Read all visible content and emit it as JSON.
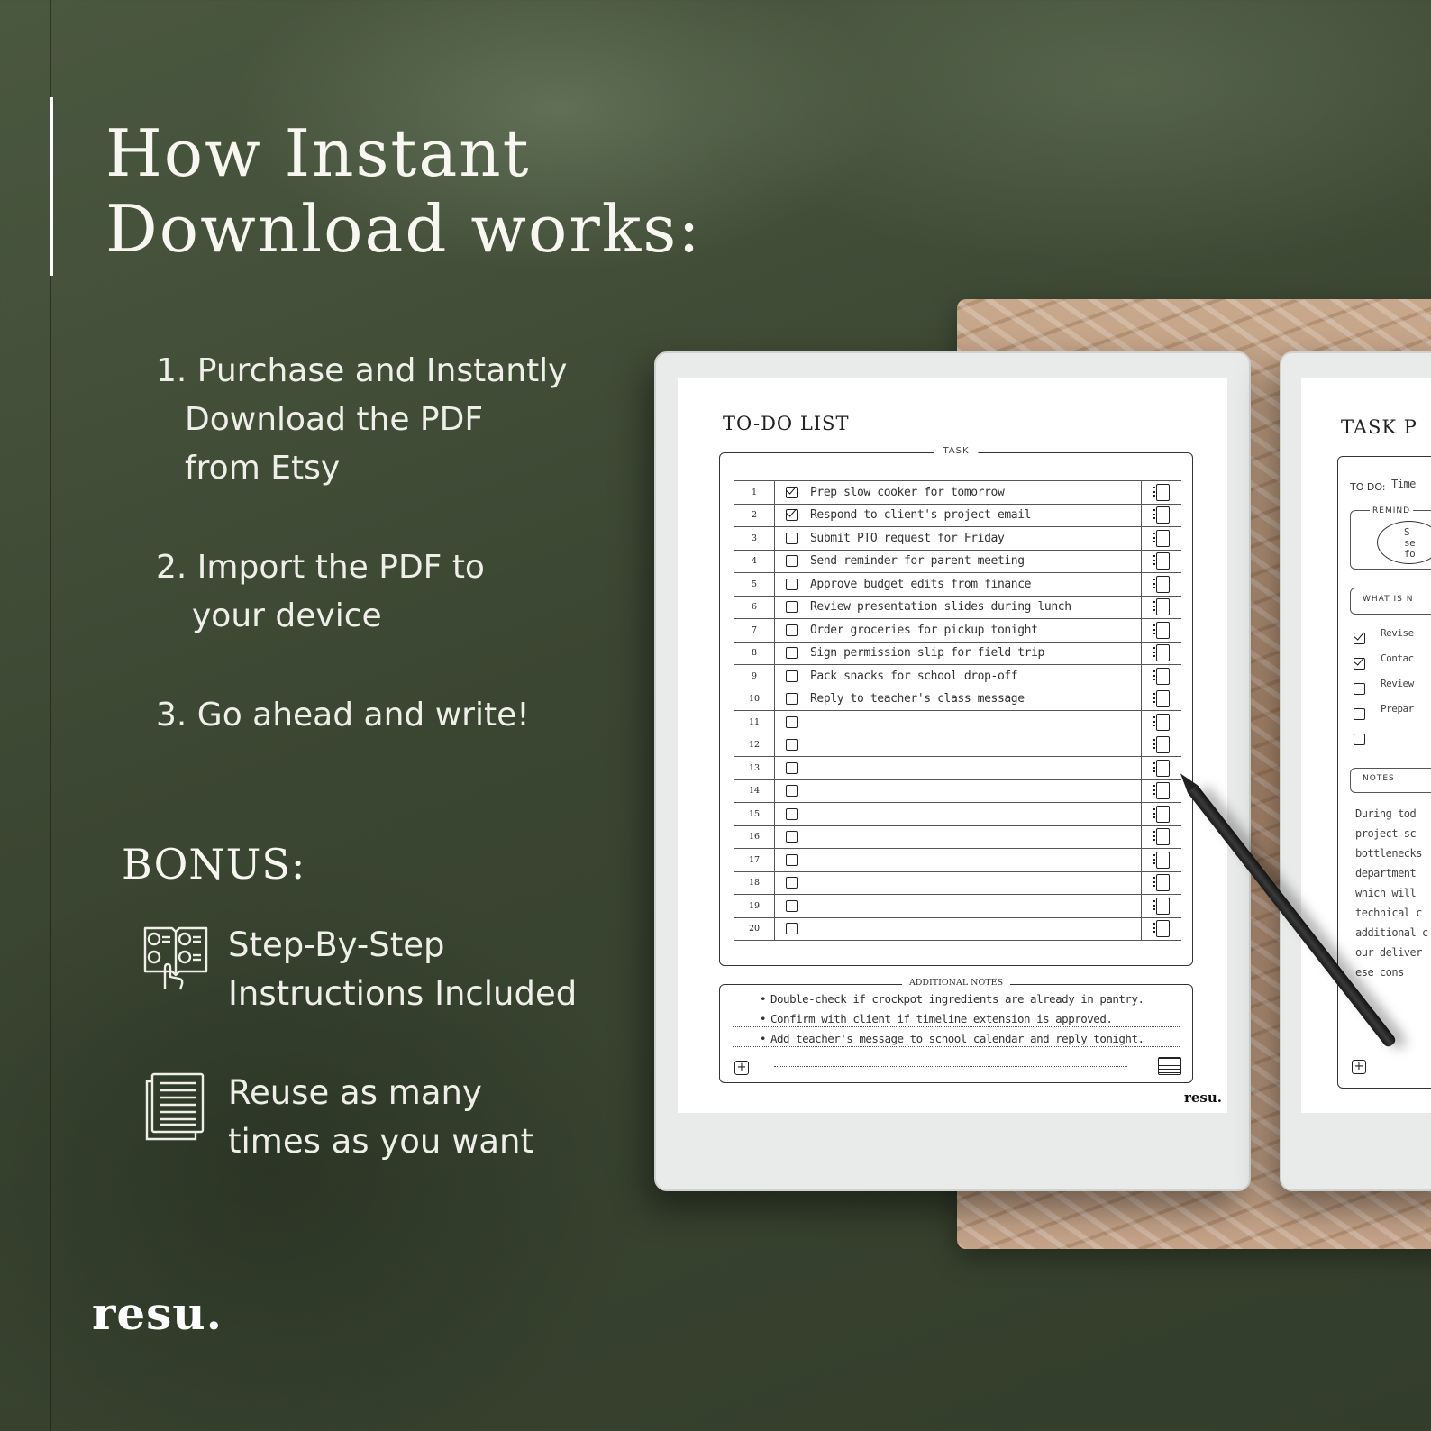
{
  "heading": {
    "line1": "How Instant",
    "line2": "Download works:"
  },
  "steps": [
    {
      "lines": [
        "1. Purchase and Instantly",
        "Download the PDF",
        "from Etsy"
      ]
    },
    {
      "lines": [
        "2. Import the PDF to",
        "your device"
      ]
    },
    {
      "lines": [
        "3. Go ahead and write!"
      ]
    }
  ],
  "bonus": {
    "title": "BONUS:",
    "items": [
      {
        "icon": "numbered-steps-book-icon",
        "lines": [
          "Step-By-Step",
          "Instructions Included"
        ]
      },
      {
        "icon": "stacked-pages-icon",
        "lines": [
          "Reuse as many",
          "times as you want"
        ]
      }
    ]
  },
  "brand": "resu.",
  "todo_page": {
    "title": "TO-DO LIST",
    "task_label": "TASK",
    "rows": [
      {
        "num": "1",
        "checked": true,
        "task": "Prep slow cooker for tomorrow"
      },
      {
        "num": "2",
        "checked": true,
        "task": "Respond to client's project email"
      },
      {
        "num": "3",
        "checked": false,
        "task": "Submit PTO request for Friday"
      },
      {
        "num": "4",
        "checked": false,
        "task": "Send reminder for parent meeting"
      },
      {
        "num": "5",
        "checked": false,
        "task": "Approve budget edits from finance"
      },
      {
        "num": "6",
        "checked": false,
        "task": "Review presentation slides during lunch"
      },
      {
        "num": "7",
        "checked": false,
        "task": "Order groceries for pickup tonight"
      },
      {
        "num": "8",
        "checked": false,
        "task": "Sign permission slip for field trip"
      },
      {
        "num": "9",
        "checked": false,
        "task": "Pack snacks for school drop-off"
      },
      {
        "num": "10",
        "checked": false,
        "task": "Reply to teacher's class message"
      },
      {
        "num": "11",
        "checked": false,
        "task": ""
      },
      {
        "num": "12",
        "checked": false,
        "task": ""
      },
      {
        "num": "13",
        "checked": false,
        "task": ""
      },
      {
        "num": "14",
        "checked": false,
        "task": ""
      },
      {
        "num": "15",
        "checked": false,
        "task": ""
      },
      {
        "num": "16",
        "checked": false,
        "task": ""
      },
      {
        "num": "17",
        "checked": false,
        "task": ""
      },
      {
        "num": "18",
        "checked": false,
        "task": ""
      },
      {
        "num": "19",
        "checked": false,
        "task": ""
      },
      {
        "num": "20",
        "checked": false,
        "task": ""
      }
    ],
    "notes_label": "ADDITIONAL NOTES",
    "notes": [
      "Double-check if crockpot ingredients are already in pantry.",
      "Confirm with client if timeline extension is approved.",
      "Add teacher's message to school calendar and reply tonight."
    ],
    "brand": "resu."
  },
  "task_page": {
    "title": "TASK P",
    "todo_label": "TO DO:",
    "todo_value": "Time",
    "reminder_label": "REMIND",
    "reminder_lines": [
      "S",
      "se",
      "fo"
    ],
    "what_label": "WHAT IS N",
    "items": [
      {
        "checked": true,
        "text": "Revise"
      },
      {
        "checked": true,
        "text": "Contac"
      },
      {
        "checked": false,
        "text": "Review"
      },
      {
        "checked": false,
        "text": "Prepar"
      },
      {
        "checked": false,
        "text": ""
      }
    ],
    "notes_label": "NOTES",
    "notes_lines": [
      "During tod",
      "project sc",
      "bottlenecks",
      "department",
      "which will",
      "technical c",
      "additional c",
      "our deliver",
      "ese cons"
    ]
  }
}
